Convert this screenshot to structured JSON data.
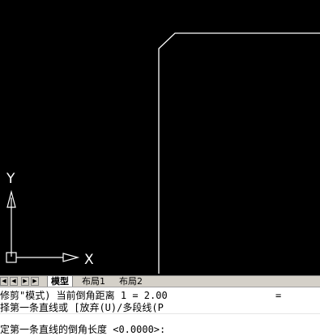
{
  "ucs": {
    "y_label": "Y",
    "x_label": "X"
  },
  "tabs": {
    "nav_icons": [
      "first-tab-icon",
      "prev-tab-icon",
      "next-tab-icon",
      "last-tab-icon"
    ],
    "items": [
      {
        "label": "模型",
        "active": true
      },
      {
        "label": "布局1",
        "active": false
      },
      {
        "label": "布局2",
        "active": false
      }
    ]
  },
  "command": {
    "history_line_1": "修剪\"模式) 当前倒角距离 1 = 2.00",
    "history_line_1_tail": "= ",
    "history_line_2": "择第一条直线或 [放弃(U)/多段线(P",
    "prompt_line": "定第一条直线的倒角长度 <0.0000>:"
  },
  "colors": {
    "canvas": "#000000",
    "lines": "#ffffff",
    "command_bg": "#ffffff"
  }
}
